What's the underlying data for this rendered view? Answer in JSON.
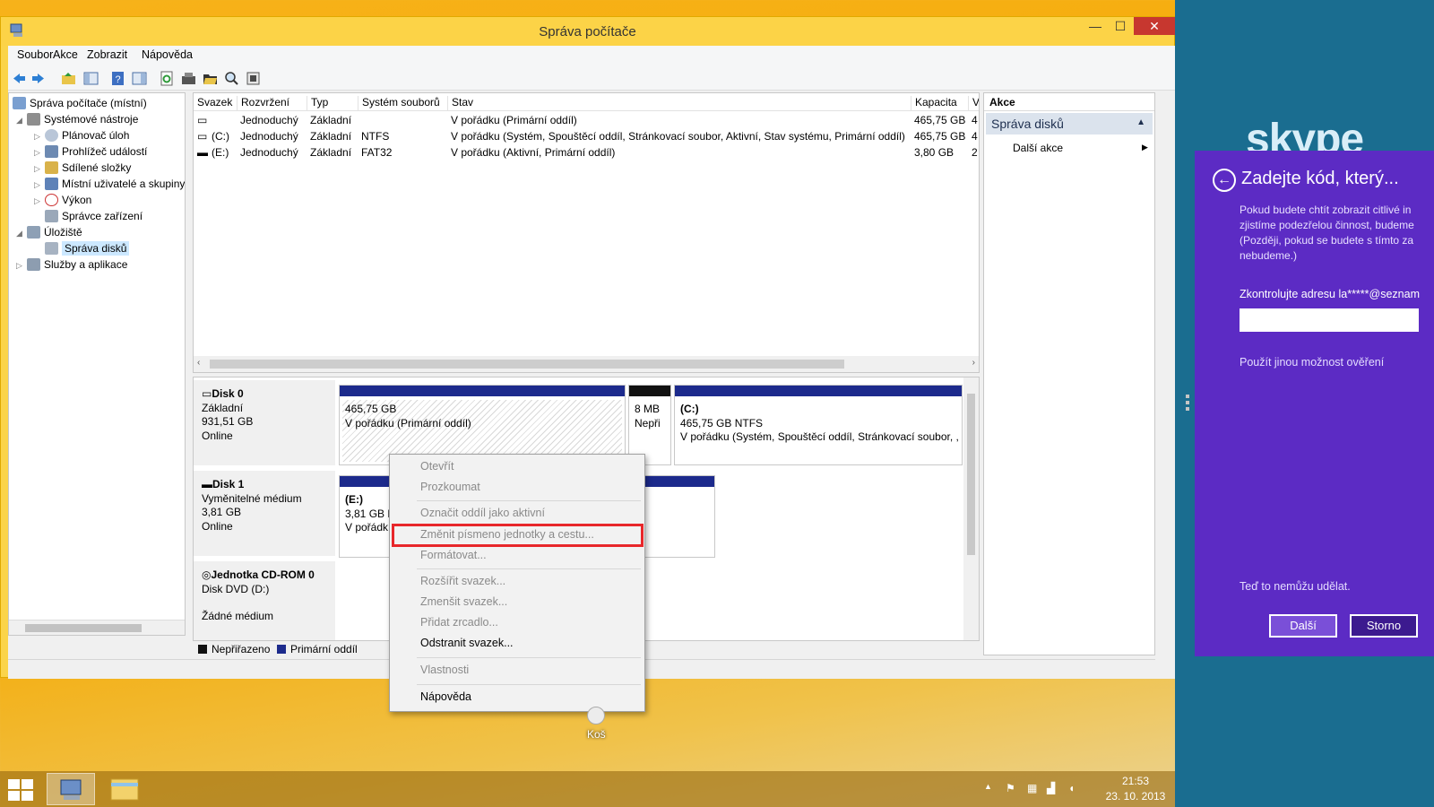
{
  "window": {
    "title": "Správa počítače",
    "controls": {
      "minimize": "—",
      "maximize": "☐",
      "close": "✕"
    }
  },
  "menu": [
    "Soubor",
    "Akce",
    "Zobrazit",
    "Nápověda"
  ],
  "toolbar_icons": [
    "back-icon",
    "forward-icon",
    "up-folder-icon",
    "show-hide-tree-icon",
    "help-icon",
    "properties-icon",
    "refresh-icon",
    "disk-icon",
    "open-folder-icon",
    "search-icon",
    "settings-icon"
  ],
  "tree": {
    "root": "Správa počítače (místní)",
    "items": [
      {
        "label": "Systémové nástroje",
        "level": 1,
        "arrow": "◢"
      },
      {
        "label": "Plánovač úloh",
        "level": 2,
        "arrow": "▷"
      },
      {
        "label": "Prohlížeč událostí",
        "level": 2,
        "arrow": "▷"
      },
      {
        "label": "Sdílené složky",
        "level": 2,
        "arrow": "▷"
      },
      {
        "label": "Místní uživatelé a skupiny",
        "level": 2,
        "arrow": "▷"
      },
      {
        "label": "Výkon",
        "level": 2,
        "arrow": "▷"
      },
      {
        "label": "Správce zařízení",
        "level": 2,
        "arrow": ""
      },
      {
        "label": "Úložiště",
        "level": 1,
        "arrow": "◢"
      },
      {
        "label": "Správa disků",
        "level": 2,
        "arrow": "",
        "selected": true
      },
      {
        "label": "Služby a aplikace",
        "level": 1,
        "arrow": "▷"
      }
    ]
  },
  "volumes": {
    "headers": [
      "Svazek",
      "Rozvržení",
      "Typ",
      "Systém souborů",
      "Stav",
      "Kapacita",
      "V"
    ],
    "rows": [
      [
        "",
        "Jednoduchý",
        "Základní",
        "",
        "V pořádku (Primární oddíl)",
        "465,75 GB",
        "4"
      ],
      [
        "(C:)",
        "Jednoduchý",
        "Základní",
        "NTFS",
        "V pořádku (Systém, Spouštěcí oddíl, Stránkovací soubor, Aktivní, Stav systému, Primární oddíl)",
        "465,75 GB",
        "4"
      ],
      [
        "(E:)",
        "Jednoduchý",
        "Základní",
        "FAT32",
        "V pořádku (Aktivní, Primární oddíl)",
        "3,80 GB",
        "2"
      ]
    ]
  },
  "disks": {
    "disk0": {
      "name": "Disk 0",
      "type": "Základní",
      "size": "931,51 GB",
      "status": "Online",
      "p1_size": "465,75 GB",
      "p1_status": "V pořádku (Primární oddíl)",
      "p2_size": "8 MB",
      "p2_status": "Nepři",
      "p3_label": "(C:)",
      "p3_size": "465,75 GB NTFS",
      "p3_status": "V pořádku (Systém, Spouštěcí oddíl, Stránkovací soubor, ,"
    },
    "disk1": {
      "name": "Disk 1",
      "type": "Vyměnitelné médium",
      "size": "3,81 GB",
      "status": "Online",
      "p1_label": "(E:)",
      "p1_size": "3,81 GB F",
      "p1_status": "V pořádk"
    },
    "cdrom": {
      "name": "Jednotka CD-ROM 0",
      "type": "Disk DVD (D:)",
      "status": "Žádné médium"
    }
  },
  "legend": {
    "unallocated": "Nepřiřazeno",
    "primary": "Primární oddíl",
    "unallocated_color": "#111111",
    "primary_color": "#1c2a8c"
  },
  "actions": {
    "header": "Akce",
    "section": "Správa disků",
    "more": "Další akce",
    "section_arrow": "▲",
    "more_arrow": "▶"
  },
  "context_menu": {
    "items": [
      {
        "label": "Otevřít",
        "enabled": false
      },
      {
        "label": "Prozkoumat",
        "enabled": false
      },
      {
        "label": "Označit oddíl jako aktivní",
        "enabled": false
      },
      {
        "label": "Změnit písmeno jednotky a cestu...",
        "enabled": false,
        "highlighted": true
      },
      {
        "label": "Formátovat...",
        "enabled": false
      },
      {
        "label": "Rozšířit svazek...",
        "enabled": false
      },
      {
        "label": "Zmenšit svazek...",
        "enabled": false
      },
      {
        "label": "Přidat zrcadlo...",
        "enabled": false
      },
      {
        "label": "Odstranit svazek...",
        "enabled": true
      },
      {
        "label": "Vlastnosti",
        "enabled": false
      },
      {
        "label": "Nápověda",
        "enabled": true
      }
    ]
  },
  "desktop": {
    "recycle_bin": "Koš"
  },
  "taskbar": {
    "time": "21:53",
    "date": "23. 10. 2013",
    "tray_arrow": "▲"
  },
  "skype_panel": {
    "logo": "skype",
    "title": "Zadejte kód, který...",
    "description": "Pokud budete chtít zobrazit citlivé in zjistíme podezřelou činnost, budeme (Později, pokud se budete s tímto za nebudeme.)",
    "check_label": "Zkontrolujte adresu la*****@seznam",
    "input_value": "",
    "other_option": "Použít jinou možnost ověření",
    "cant_now": "Teď to nemůžu udělat.",
    "next": "Další",
    "cancel": "Storno",
    "back_arrow": "←"
  },
  "colors": {
    "accent_purple": "#5c2bc4",
    "charm_blue": "#1a6d90",
    "highlight_red": "#e8272b",
    "disk_blue": "#1c2a8c"
  }
}
